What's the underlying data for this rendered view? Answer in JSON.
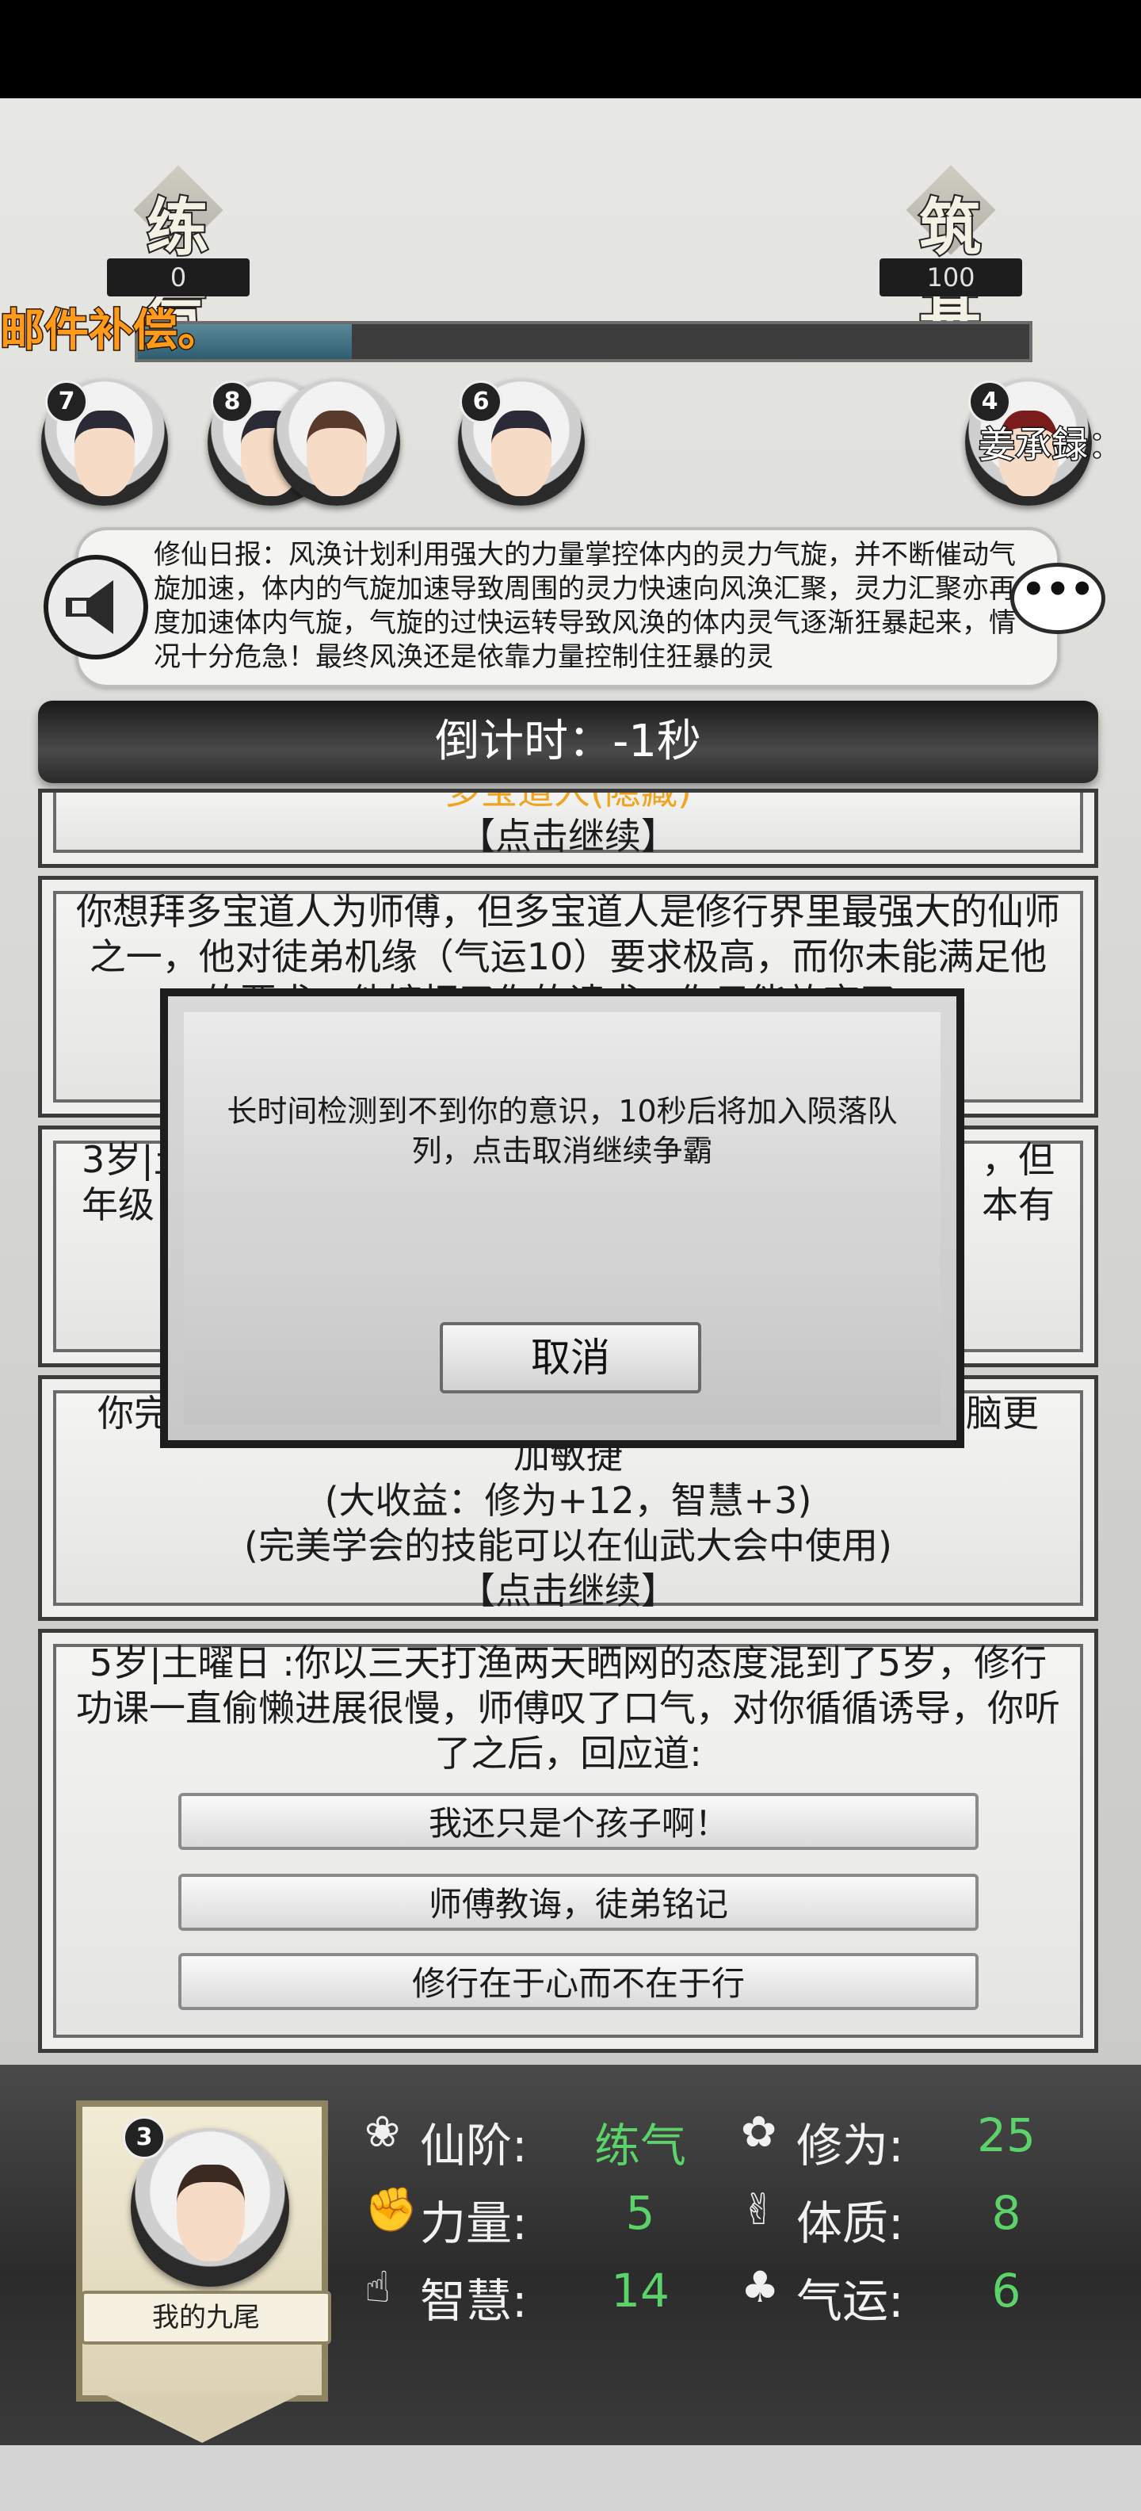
{
  "header": {
    "realm_left": {
      "name": "练气",
      "value": "0"
    },
    "realm_right": {
      "name": "筑基",
      "value": "100"
    },
    "progress": 0.24,
    "marquee": "邮件补偿。"
  },
  "avatars": [
    {
      "count": "7",
      "hair": "#2a2b36"
    },
    {
      "count": "8",
      "hair": "#2a2b36"
    },
    {
      "count": "",
      "hair": "#5a3a2a"
    },
    {
      "count": "6",
      "hair": "#2a2b36"
    },
    {
      "count": "4",
      "hair": "#7a1c1c"
    }
  ],
  "speaker_label": "姜承録：",
  "news": {
    "text": "修仙日报：风涣计划利用强大的力量掌控体内的灵力气旋，并不断催动气旋加速，体内的气旋加速导致周围的灵力快速向风涣汇聚，灵力汇聚亦再度加速体内气旋，气旋的过快运转导致风涣的体内灵气逐渐狂暴起来，情况十分危急！最终风涣还是依靠力量控制住狂暴的灵",
    "more_icon": "•••"
  },
  "countdown": "倒计时：-1秒",
  "cards": {
    "card1": {
      "line1": "多宝道人(隐藏)",
      "continue": "【点击继续】"
    },
    "card2": {
      "text": "你想拜多宝道人为师傅，但多宝道人是修行界里最强大的仙师之一，他对徒弟机缘（气运10）要求极高，而你未能满足他的要求，他婉拒了你的请求，你只能放弃了。"
    },
    "card3": {
      "text_left": "3岁|土",
      "text_right": "，但",
      "line2_left": "年级",
      "line2_right": "本有"
    },
    "card4": {
      "line1_left": "你完",
      "line1_right": "脑更",
      "line2": "加敏捷",
      "line3": "(大收益：修为+12，智慧+3)",
      "line4": "(完美学会的技能可以在仙武大会中使用)",
      "continue": "【点击继续】"
    },
    "card5": {
      "text": "5岁|土曜日 :你以三天打渔两天晒网的态度混到了5岁，修行功课一直偷懒进展很慢，师傅叹了口气，对你循循诱导，你听了之后，回应道:",
      "choices": [
        "我还只是个孩子啊！",
        "师傅教诲，徒弟铭记",
        "修行在于心而不在于行"
      ]
    }
  },
  "dialog": {
    "message": "长时间检测到不到你的意识，10秒后将加入陨落队列，点击取消继续争霸",
    "cancel": "取消"
  },
  "player": {
    "count": "3",
    "name": "我的九尾",
    "stats": [
      {
        "icon": "realm-icon",
        "glyph": "❀",
        "label": "仙阶:",
        "value": "练气"
      },
      {
        "icon": "cultivation-icon",
        "glyph": "✿",
        "label": "修为:",
        "value": "25"
      },
      {
        "icon": "strength-icon",
        "glyph": "✊",
        "label": "力量:",
        "value": "5"
      },
      {
        "icon": "constitution-icon",
        "glyph": "✌",
        "label": "体质:",
        "value": "8"
      },
      {
        "icon": "wisdom-icon",
        "glyph": "☝",
        "label": "智慧:",
        "value": "14"
      },
      {
        "icon": "luck-icon",
        "glyph": "♣",
        "label": "气运:",
        "value": "6"
      }
    ]
  }
}
